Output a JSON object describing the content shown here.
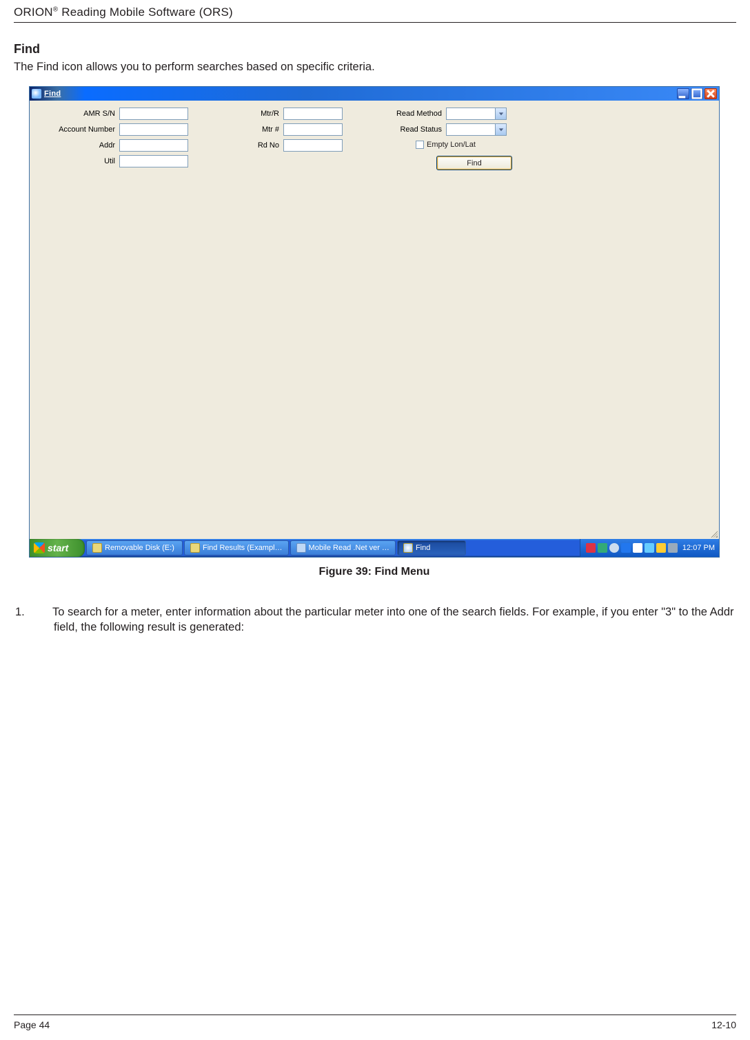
{
  "doc": {
    "header_pre": "ORION",
    "header_sup": "®",
    "header_post": " Reading Mobile Software (ORS)",
    "section_title": "Find",
    "section_desc": "The Find icon allows you to perform searches based on specific criteria.",
    "caption": "Figure 39:  Find Menu",
    "step_num": "1.",
    "step_text": "To search for a meter, enter information about the particular meter into one of the search fields.  For example, if you enter \"3\" to the Addr field, the following result is generated:",
    "page_left": "Page 44",
    "page_right": "12-10"
  },
  "win": {
    "title": "Find",
    "labels": {
      "amr": "AMR S/N",
      "acct": "Account Number",
      "addr": "Addr",
      "util": "Util",
      "mtrr": "Mtr/R",
      "mtrnum": "Mtr #",
      "rdno": "Rd No",
      "readmethod": "Read Method",
      "readstatus": "Read Status",
      "emptylonlat": "Empty Lon/Lat"
    },
    "find_button": "Find"
  },
  "taskbar": {
    "start": "start",
    "items": [
      "Removable Disk (E:)",
      "Find Results (Exampl…",
      "Mobile Read .Net ver …",
      "Find"
    ],
    "clock": "12:07 PM"
  }
}
